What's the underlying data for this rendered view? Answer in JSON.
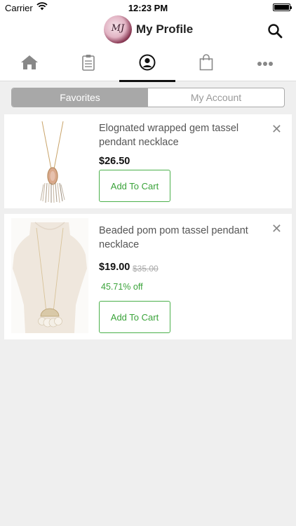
{
  "status_bar": {
    "carrier": "Carrier",
    "time": "12:23 PM"
  },
  "header": {
    "logo_text": "MJ",
    "title": "My Profile",
    "search_icon": "search-icon"
  },
  "tabs": [
    {
      "icon": "home-icon",
      "active": false
    },
    {
      "icon": "clipboard-icon",
      "active": false
    },
    {
      "icon": "profile-icon",
      "active": true
    },
    {
      "icon": "shopping-bag-icon",
      "active": false
    },
    {
      "icon": "more-icon",
      "active": false
    }
  ],
  "segment": {
    "favorites": "Favorites",
    "account": "My Account",
    "selected": "Favorites"
  },
  "favorites": [
    {
      "name": "Elognated wrapped gem tassel pendant necklace",
      "price": "$26.50",
      "cart_label": "Add To Cart"
    },
    {
      "name": "Beaded pom pom tassel pendant necklace",
      "price": "$19.00",
      "original_price": "$35.00",
      "discount": "45.71% off",
      "cart_label": "Add To Cart"
    }
  ],
  "colors": {
    "accent_green": "#3aa33a",
    "segment_active": "#a8a8a8",
    "background": "#efefef"
  }
}
